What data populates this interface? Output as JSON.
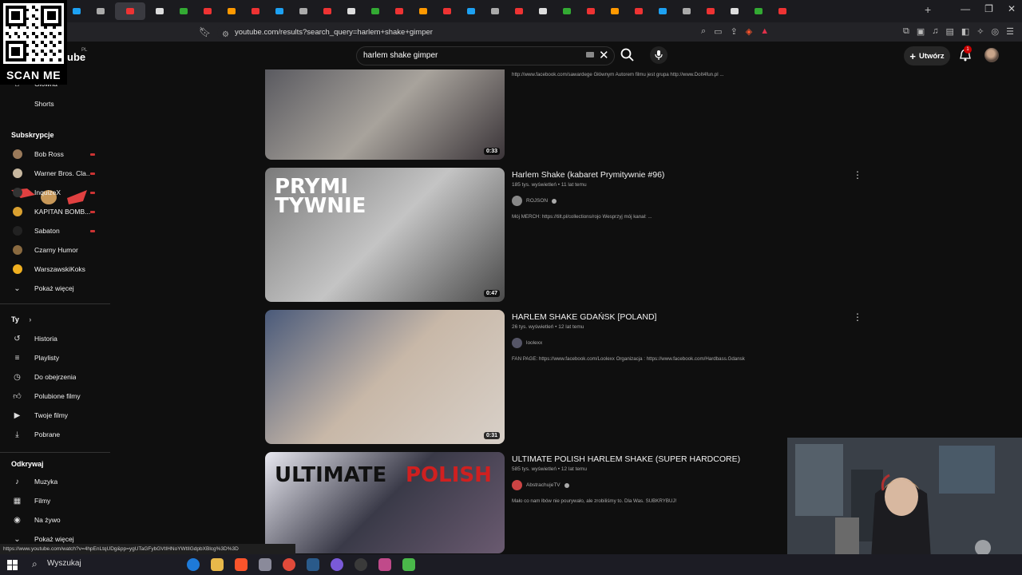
{
  "browser": {
    "tabs_count": 30,
    "url": "youtube.com/results?search_query=harlem+shake+gimper",
    "status_url": "https://www.youtube.com/watch?v=4hpEnLtqUDg&pp=ygUTaGFybGVtIHNoYWtlIGdpbXBlcg%3D%3D"
  },
  "overlay": {
    "scan_label": "SCAN ME"
  },
  "header": {
    "logo_text": "ube",
    "logo_region": "PL",
    "search_query": "harlem shake gimper",
    "create_label": "Utwórz",
    "notif_count": "1"
  },
  "sidebar": {
    "main": [
      {
        "label": "Główna",
        "icon": "home-icon"
      },
      {
        "label": "Shorts",
        "icon": "shorts-icon"
      }
    ],
    "subs_header": "Subskrypcje",
    "subscriptions": [
      {
        "label": "Bob Ross",
        "color": "#9a7a5a",
        "live": true
      },
      {
        "label": "Warner Bros. Cla...",
        "color": "#c8b8a0",
        "live": true
      },
      {
        "label": "InquizeX",
        "color": "#333333",
        "live": true
      },
      {
        "label": "KAPITAN BOMB...",
        "color": "#d9a030",
        "live": true
      },
      {
        "label": "Sabaton",
        "color": "#222222",
        "live": true
      },
      {
        "label": "Czarny Humor",
        "color": "#8a6a40",
        "live": false
      },
      {
        "label": "WarszawskiKoks",
        "color": "#f0b020",
        "live": false
      }
    ],
    "show_more": "Pokaż więcej",
    "you_header": "Ty",
    "you": [
      {
        "label": "Historia",
        "icon": "history-icon"
      },
      {
        "label": "Playlisty",
        "icon": "playlist-icon"
      },
      {
        "label": "Do obejrzenia",
        "icon": "watch-later-icon"
      },
      {
        "label": "Polubione filmy",
        "icon": "like-icon"
      },
      {
        "label": "Twoje filmy",
        "icon": "your-videos-icon"
      },
      {
        "label": "Pobrane",
        "icon": "download-icon"
      }
    ],
    "explore_header": "Odkrywaj",
    "explore": [
      {
        "label": "Muzyka",
        "icon": "music-icon"
      },
      {
        "label": "Filmy",
        "icon": "movies-icon"
      },
      {
        "label": "Na żywo",
        "icon": "live-icon"
      }
    ],
    "show_more_2": "Pokaż więcej"
  },
  "results": [
    {
      "title": "",
      "views": "",
      "channel": "",
      "desc": "http://www.facebook.com/sawardege Głównym Autorem filmu jest grupa http://www.DoIt4fun.pl ...",
      "duration": "0:33",
      "thumb_colors": [
        "#5a5a60",
        "#a8a39c",
        "#3a3438"
      ]
    },
    {
      "title": "Harlem Shake (kabaret Prymitywnie #96)",
      "views": "185 tys. wyświetleń • 11 lat temu",
      "channel": "ROJSON",
      "desc": "Mój MERCH: https://tilt.pl/collections/rojo Wesprzyj mój kanał: ...",
      "duration": "0:47",
      "thumb_title": "PRYMI TYWNIE",
      "thumb_colors": [
        "#7a7a7a",
        "#c4c4c4",
        "#4a4a4a"
      ]
    },
    {
      "title": "HARLEM SHAKE GDAŃSK [POLAND]",
      "views": "26 tys. wyświetleń • 12 lat temu",
      "channel": "loolexx",
      "desc": "FAN PAGE: https://www.facebook.com/Loolexx Organizacja : https://www.facebook.com/Hardbass.Gdansk",
      "duration": "0:31",
      "thumb_colors": [
        "#4a5a7a",
        "#c8b8a8",
        "#d8d0c8"
      ]
    },
    {
      "title": "ULTIMATE POLISH HARLEM SHAKE (SUPER HARDCORE)",
      "views": "585 tys. wyświetleń • 12 lat temu",
      "channel": "AbstrachujeTV",
      "desc": "Mało co nam łbów nie pourywało, ale zrobiliśmy to. Dla Was. SUBKRYBUJ!",
      "duration": "",
      "thumb_title_1": "ULTIMATE",
      "thumb_title_2": "POLISH",
      "thumb_colors": [
        "#e8e8f0",
        "#3a3a48",
        "#6a5a70"
      ]
    }
  ],
  "taskbar": {
    "search_label": "Wyszukaj"
  }
}
